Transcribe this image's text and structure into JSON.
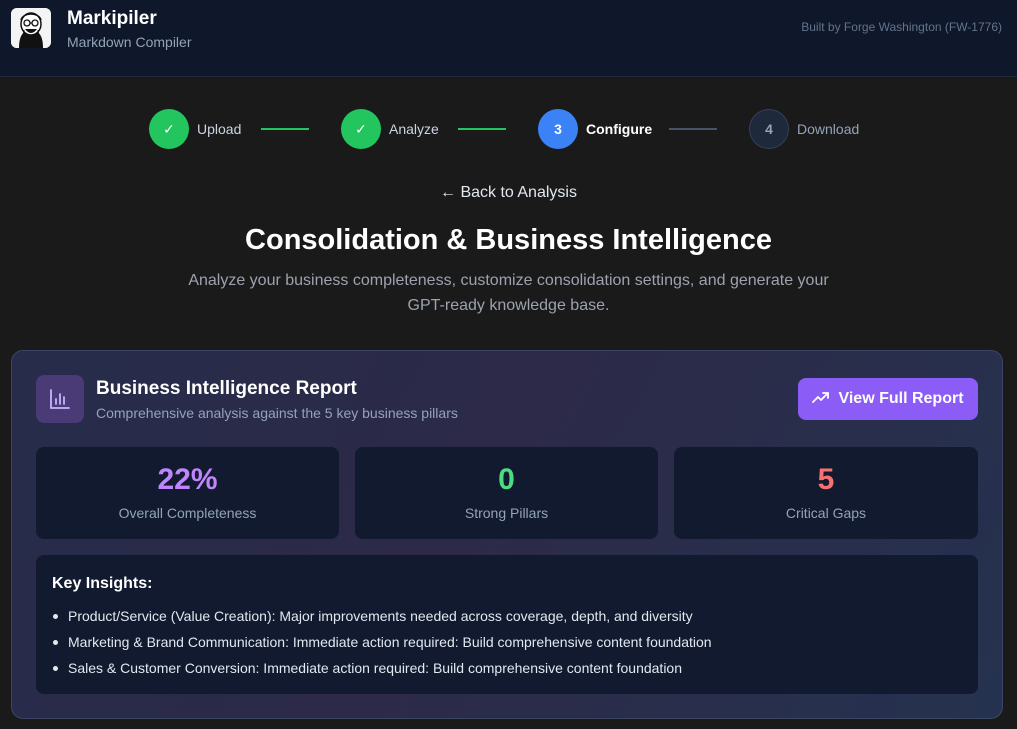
{
  "header": {
    "app_title": "Markipiler",
    "app_subtitle": "Markdown Compiler",
    "built_by": "Built by Forge Washington (FW-1776)",
    "logo_icon": "cartoon-face-logo"
  },
  "stepper": {
    "steps": [
      {
        "number": "✓",
        "label": "Upload",
        "status": "done"
      },
      {
        "number": "✓",
        "label": "Analyze",
        "status": "done"
      },
      {
        "number": "3",
        "label": "Configure",
        "status": "active"
      },
      {
        "number": "4",
        "label": "Download",
        "status": "pending"
      }
    ]
  },
  "page": {
    "back_link": "← Back to Analysis",
    "title": "Consolidation & Business Intelligence",
    "description": "Analyze your business completeness, customize consolidation settings, and generate your GPT-ready knowledge base."
  },
  "report": {
    "icon": "bar-chart-icon",
    "title": "Business Intelligence Report",
    "subtitle": "Comprehensive analysis against the 5 key business pillars",
    "button_label": "View Full Report",
    "button_icon": "trending-up-icon",
    "stats": [
      {
        "value": "22%",
        "label": "Overall Completeness",
        "color": "#c084fc"
      },
      {
        "value": "0",
        "label": "Strong Pillars",
        "color": "#4ade80"
      },
      {
        "value": "5",
        "label": "Critical Gaps",
        "color": "#f87171"
      }
    ],
    "insights_title": "Key Insights:",
    "insights": [
      "Product/Service (Value Creation): Major improvements needed across coverage, depth, and diversity",
      "Marketing & Brand Communication: Immediate action required: Build comprehensive content foundation",
      "Sales & Customer Conversion: Immediate action required: Build comprehensive content foundation"
    ]
  },
  "colors": {
    "accent_purple": "#8b5cf6",
    "success_green": "#22c55e",
    "active_blue": "#3b82f6"
  }
}
